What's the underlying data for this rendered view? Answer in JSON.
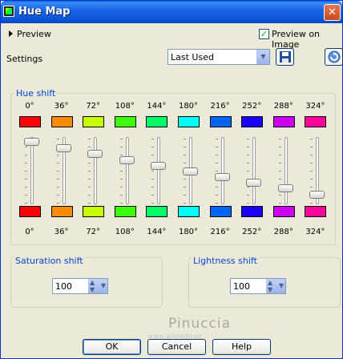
{
  "window": {
    "title": "Hue Map",
    "close_glyph": "✕"
  },
  "preview": {
    "label": "Preview",
    "checkbox_label": "Preview on Image",
    "checked": true
  },
  "settings": {
    "label": "Settings",
    "value": "Last Used"
  },
  "hue_shift": {
    "caption": "Hue shift",
    "columns": [
      {
        "deg": "0°",
        "color": "#ff0000",
        "bottom_color": "#ff0000",
        "level": 0.98
      },
      {
        "deg": "36°",
        "color": "#ff8c00",
        "bottom_color": "#ff8c00",
        "level": 0.88
      },
      {
        "deg": "72°",
        "color": "#c8ff00",
        "bottom_color": "#c8ff00",
        "level": 0.78
      },
      {
        "deg": "108°",
        "color": "#3cff00",
        "bottom_color": "#3cff00",
        "level": 0.68
      },
      {
        "deg": "144°",
        "color": "#00ff66",
        "bottom_color": "#00ff66",
        "level": 0.58
      },
      {
        "deg": "180°",
        "color": "#00ffff",
        "bottom_color": "#00ffff",
        "level": 0.49
      },
      {
        "deg": "216°",
        "color": "#0066ff",
        "bottom_color": "#0066ff",
        "level": 0.39
      },
      {
        "deg": "252°",
        "color": "#1a00ff",
        "bottom_color": "#1a00ff",
        "level": 0.3
      },
      {
        "deg": "288°",
        "color": "#cc00ff",
        "bottom_color": "#cc00ff",
        "level": 0.2
      },
      {
        "deg": "324°",
        "color": "#ff0099",
        "bottom_color": "#ff0099",
        "level": 0.1
      }
    ]
  },
  "saturation": {
    "caption": "Saturation shift",
    "value": "100"
  },
  "lightness": {
    "caption": "Lightness shift",
    "value": "100"
  },
  "watermark": {
    "text": "Pinuccia",
    "url": "www.alidadirog..."
  },
  "buttons": {
    "ok": "OK",
    "cancel": "Cancel",
    "help": "Help"
  }
}
